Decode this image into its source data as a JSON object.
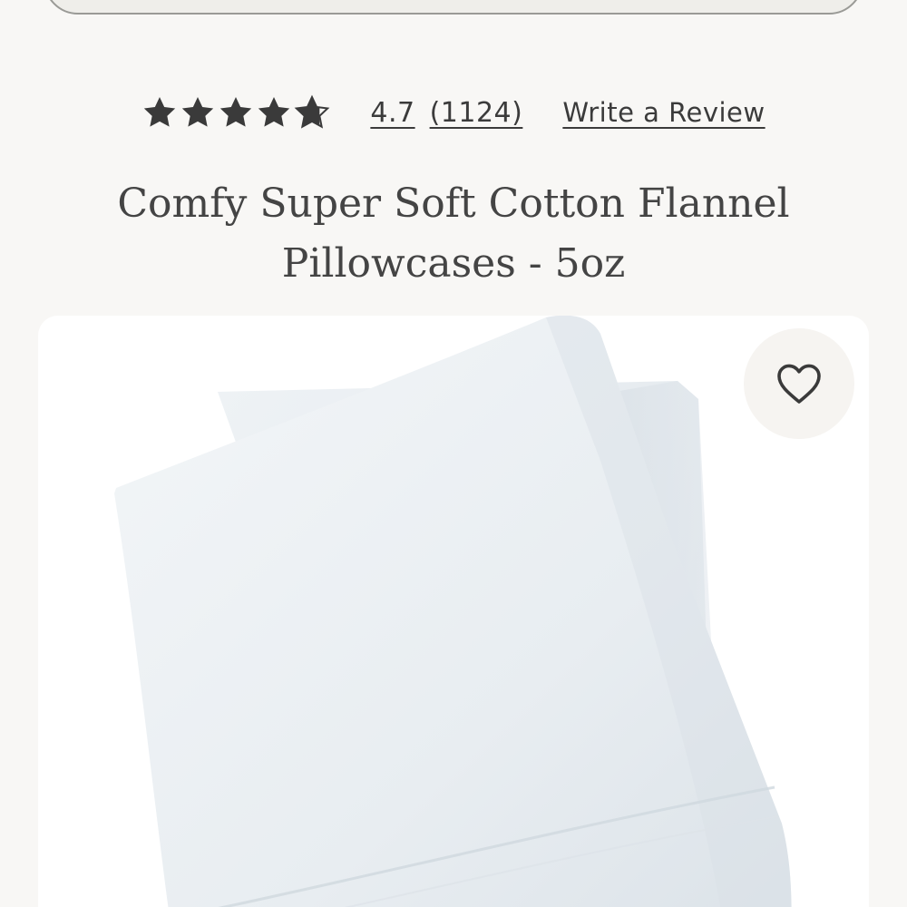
{
  "rating": {
    "stars": 4.7,
    "value_label": "4.7",
    "count_label": "(1124)",
    "write_review_label": "Write a Review"
  },
  "product": {
    "title": "Comfy Super Soft Cotton Flannel Pillowcases - 5oz",
    "image_icon": "folded-pillowcase-photo"
  },
  "favorite": {
    "icon": "heart-icon"
  },
  "colors": {
    "background": "#f8f7f5",
    "text": "#3a3a3a",
    "star": "#3a3a3a"
  }
}
